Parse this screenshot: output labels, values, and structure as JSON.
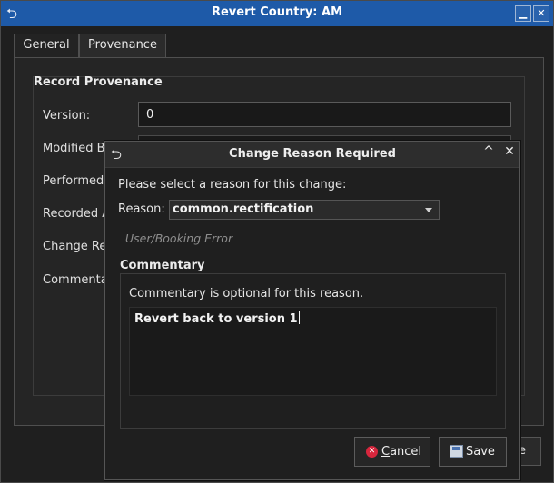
{
  "window": {
    "title": "Revert Country: AM",
    "minimize_glyph": "▁",
    "close_glyph": "✕",
    "back_glyph": "⮌"
  },
  "tabs": [
    {
      "label": "General"
    },
    {
      "label": "Provenance"
    }
  ],
  "provenance": {
    "section_title": "Record Provenance",
    "fields": [
      {
        "label": "Version:",
        "value": "0"
      },
      {
        "label": "Modified By"
      },
      {
        "label": "Performed"
      },
      {
        "label": "Recorded A"
      },
      {
        "label": "Change Rea"
      },
      {
        "label": "Commenta"
      }
    ],
    "partial_button_label": "e"
  },
  "dialog": {
    "title": "Change Reason Required",
    "back_glyph": "⮌",
    "up_glyph": "^",
    "close_glyph": "✕",
    "prompt": "Please select a reason for this change:",
    "reason_label": "Reason:",
    "reason_value": "common.rectification",
    "reason_hint": "User/Booking Error",
    "commentary_title": "Commentary",
    "commentary_note": "Commentary is optional for this reason.",
    "commentary_text": "Revert back to version 1",
    "cancel_label_u": "C",
    "cancel_label_rest": "ancel",
    "save_label": "Save"
  },
  "icons": {
    "cancel": "cancel-icon",
    "save": "save-icon"
  },
  "colors": {
    "titlebar": "#1e5aa8",
    "background": "#1f1f1f"
  }
}
